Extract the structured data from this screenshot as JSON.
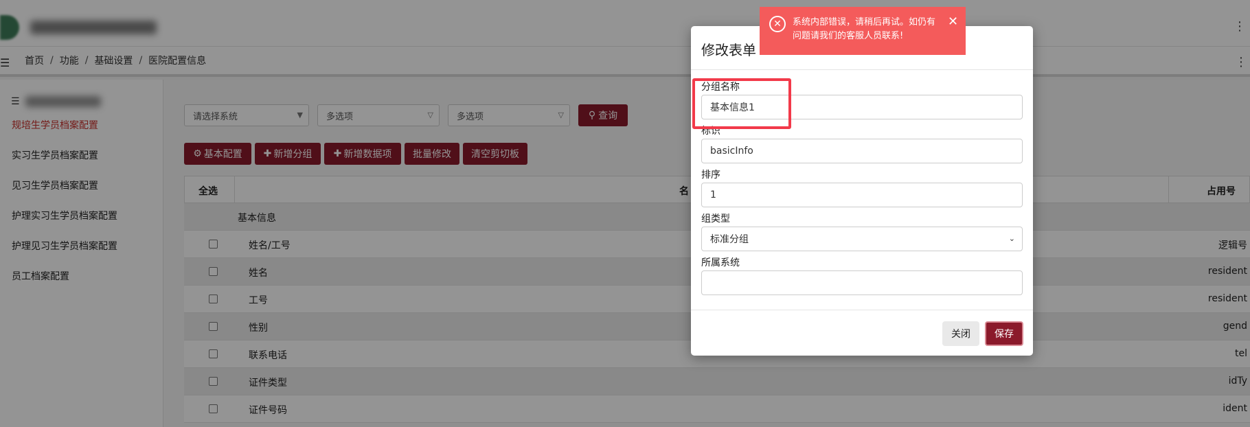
{
  "breadcrumb": [
    "首页",
    "功能",
    "基础设置",
    "医院配置信息"
  ],
  "sidebar": {
    "items": [
      {
        "label": "规培生学员档案配置",
        "active": true
      },
      {
        "label": "实习生学员档案配置",
        "active": false
      },
      {
        "label": "见习生学员档案配置",
        "active": false
      },
      {
        "label": "护理实习生学员档案配置",
        "active": false
      },
      {
        "label": "护理见习生学员档案配置",
        "active": false
      },
      {
        "label": "员工档案配置",
        "active": false
      }
    ]
  },
  "filters": {
    "system_select": "请选择系统",
    "multi_select_1": "多选项",
    "multi_select_2": "多选项",
    "query_button": "查询"
  },
  "toolbar": {
    "basic_config": "基本配置",
    "add_group": "新增分组",
    "add_data_item": "新增数据项",
    "batch_edit": "批量修改",
    "clear_clipboard": "清空剪切板"
  },
  "table": {
    "headers": {
      "select_all": "全选",
      "name": "名",
      "occupied": "占用号"
    },
    "group_row": "基本信息",
    "rows": [
      {
        "name": "姓名/工号",
        "right": "逻辑号"
      },
      {
        "name": "姓名",
        "right": "resident"
      },
      {
        "name": "工号",
        "right": "resident"
      },
      {
        "name": "性别",
        "right": "gend"
      },
      {
        "name": "联系电话",
        "right": "tel"
      },
      {
        "name": "证件类型",
        "right": "idTy"
      },
      {
        "name": "证件号码",
        "right": "ident"
      }
    ]
  },
  "modal": {
    "title": "修改表单",
    "fields": {
      "group_name": {
        "label": "分组名称",
        "value": "基本信息1"
      },
      "identifier": {
        "label": "标识",
        "value": "basicInfo"
      },
      "sort": {
        "label": "排序",
        "value": "1"
      },
      "group_type": {
        "label": "组类型",
        "value": "标准分组"
      },
      "system": {
        "label": "所属系统",
        "value": ""
      }
    },
    "close_button": "关闭",
    "save_button": "保存"
  },
  "toast": {
    "message": "系统内部错误，请稍后再试。如仍有问题请我们的客服人员联系!",
    "color": "#f45b5b"
  },
  "colors": {
    "primary": "#8b1a2b",
    "active_link": "#c9302c",
    "highlight": "#f23a4a"
  }
}
